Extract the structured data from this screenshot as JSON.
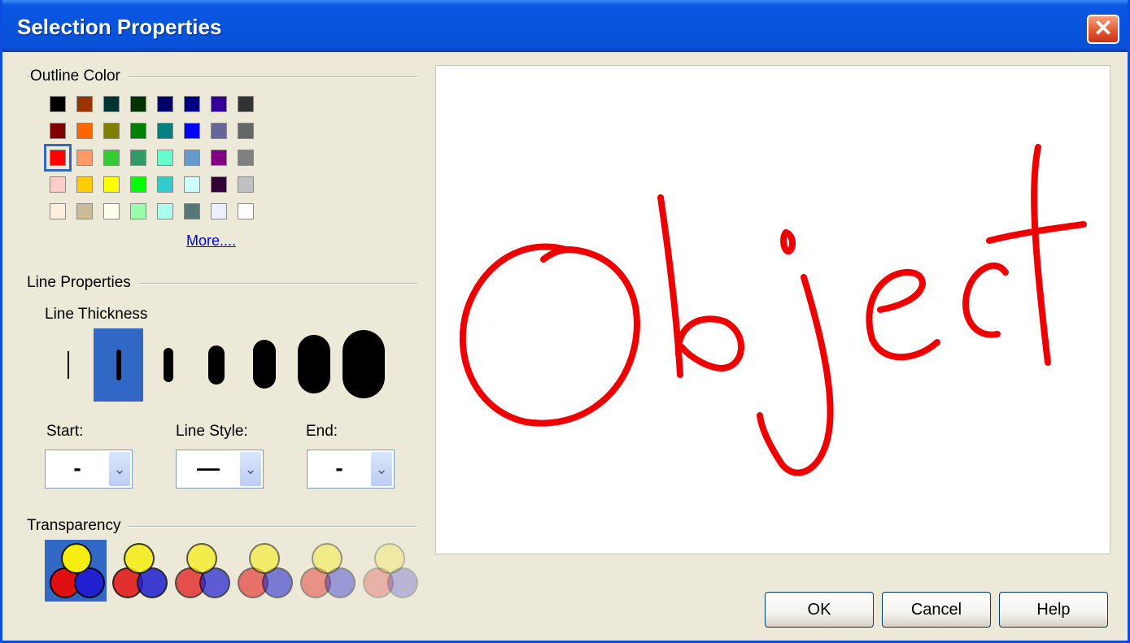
{
  "window": {
    "title": "Selection Properties",
    "close_label": "✕"
  },
  "outline": {
    "label": "Outline Color",
    "colors": [
      [
        "#000000",
        "#993300",
        "#003333",
        "#003300",
        "#000066",
        "#000080",
        "#330099",
        "#333333"
      ],
      [
        "#800000",
        "#ff6600",
        "#808000",
        "#008000",
        "#008080",
        "#0000ff",
        "#666699",
        "#666666"
      ],
      [
        "#ff0000",
        "#ff9966",
        "#33cc33",
        "#339966",
        "#66ffcc",
        "#6699cc",
        "#800080",
        "#808080"
      ],
      [
        "#ffcccc",
        "#ffcc00",
        "#ffff00",
        "#00ff00",
        "#33cccc",
        "#ccffff",
        "#330033",
        "#c0c0c0"
      ],
      [
        "#ffeedd",
        "#ccbb99",
        "#ffffee",
        "#99ffaa",
        "#aaffee",
        "#557777",
        "#eeeeff",
        "#ffffff"
      ]
    ],
    "selected": [
      2,
      0
    ],
    "more_label": "More...."
  },
  "line": {
    "label": "Line Properties",
    "thickness_label": "Line Thickness",
    "thickness_selected": 1,
    "start_label": "Start:",
    "start_value": "-",
    "style_label": "Line Style:",
    "style_value": "—",
    "end_label": "End:",
    "end_value": "-",
    "dropdown_glyph": "⌄"
  },
  "transparency": {
    "label": "Transparency",
    "selected": 0,
    "levels": [
      1.0,
      0.85,
      0.7,
      0.55,
      0.4,
      0.25
    ]
  },
  "preview": {
    "ink_color": "#ee0000",
    "text": "Object"
  },
  "buttons": {
    "ok": "OK",
    "cancel": "Cancel",
    "help": "Help"
  }
}
